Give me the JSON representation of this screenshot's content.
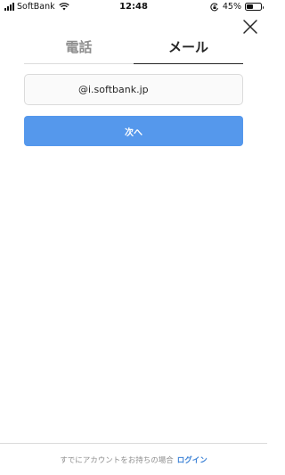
{
  "status_bar": {
    "carrier": "SoftBank",
    "time": "12:48",
    "battery_percent": "45%",
    "battery_level": 0.45,
    "icons": [
      "signal-icon",
      "wifi-icon",
      "orientation-lock-icon",
      "battery-icon"
    ]
  },
  "tabs": [
    {
      "label": "電話",
      "active": false
    },
    {
      "label": "メール",
      "active": true
    }
  ],
  "email_input": {
    "value": "@i.softbank.jp",
    "placeholder": ""
  },
  "next_button": {
    "label": "次へ"
  },
  "footer": {
    "text": "すでにアカウントをお持ちの場合",
    "login_label": "ログイン"
  },
  "colors": {
    "primary_button": "#5598ec",
    "link": "#3c82d6",
    "border": "#dbdbdb",
    "muted_text": "#8e8e8e"
  },
  "icons": {
    "close": "close-icon"
  }
}
